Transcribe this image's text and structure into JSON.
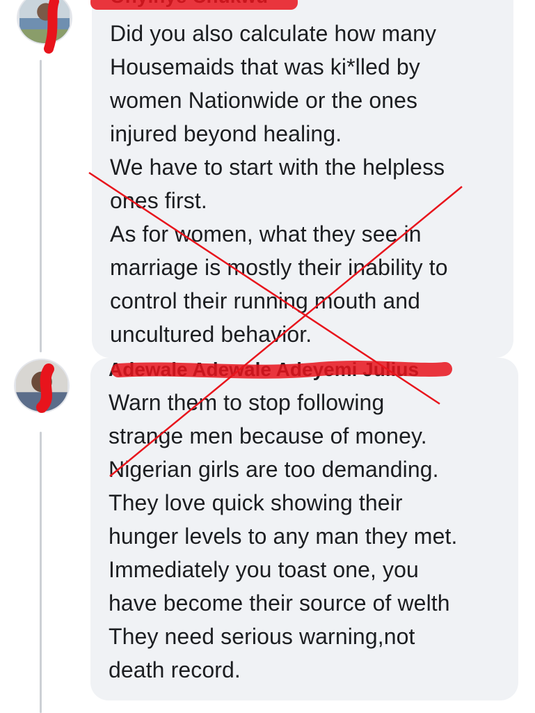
{
  "thread": {
    "comments": [
      {
        "author": "Onyinye Chukwu",
        "lines": [
          "Did you also calculate how many",
          "Housemaids that was ki*lled by",
          "women Nationwide or the ones",
          "injured beyond healing.",
          "We have to start with the helpless",
          "ones first.",
          "As for women, what they see in",
          "marriage is mostly their inability to",
          "control their running mouth and",
          "uncultured behavior."
        ]
      },
      {
        "author": "Adewale Adewale Adeyemi Julius",
        "lines": [
          "Warn them to stop following",
          "strange men because of money.",
          "Nigerian girls are too demanding.",
          "They love quick showing their",
          "hunger levels to any man they met.",
          "Immediately you toast one, you",
          "have become their source of welth",
          "They need serious warning,not",
          "death record."
        ]
      }
    ]
  },
  "colors": {
    "bubble": "#f0f2f5",
    "text": "#1c1e21",
    "redaction": "#e8141c",
    "thread_line": "#ccd0d5"
  },
  "icons": [
    "avatar-photo-1",
    "avatar-photo-2",
    "red-cross-mark"
  ]
}
